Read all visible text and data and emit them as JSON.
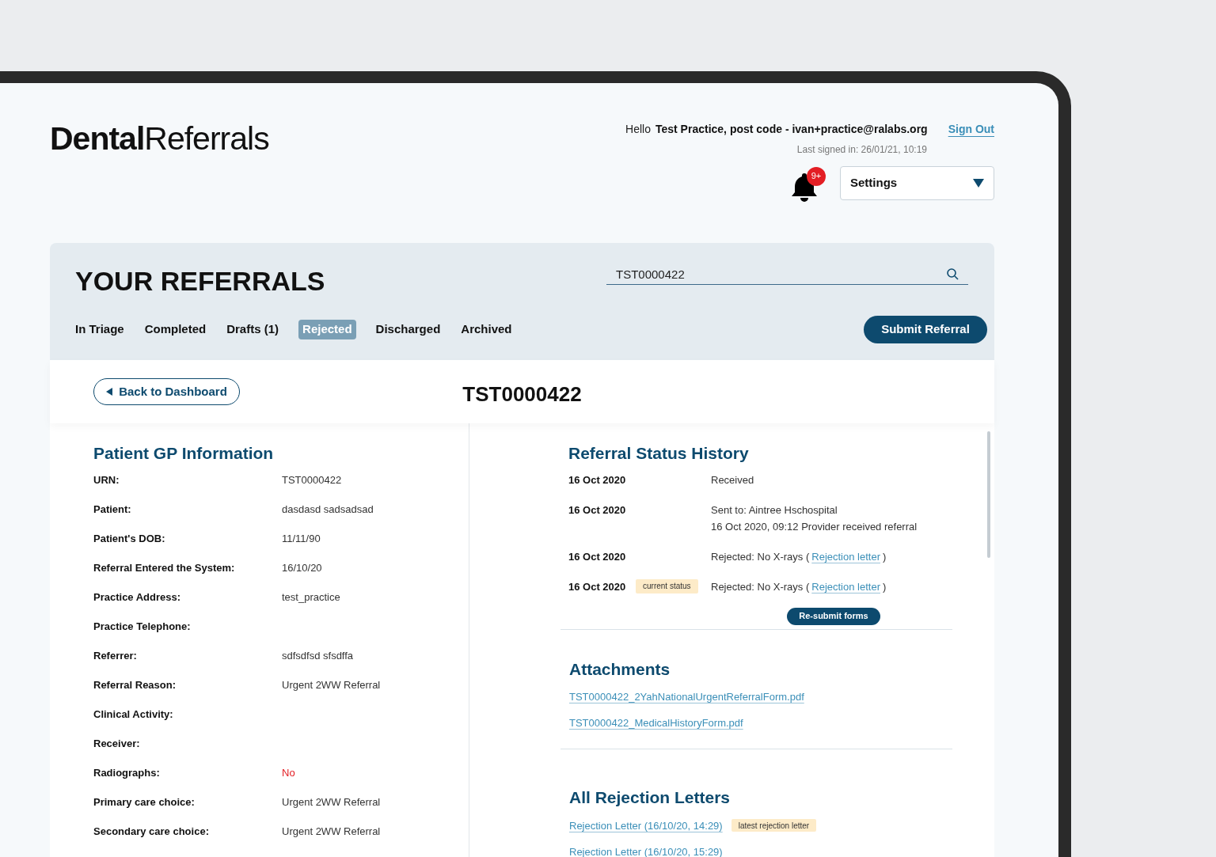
{
  "header": {
    "logo": "**Dental**Referrals",
    "greeting": "Hello",
    "user": "Test Practice, post code - ivan+practice@ralabs.org",
    "sign_out": "Sign Out",
    "last_signed": "Last signed in: 26/01/21, 10:19",
    "notifications": "9+",
    "settings": "Settings"
  },
  "panel": {
    "title": "YOUR REFERRALS",
    "search": {
      "value": "TST0000422"
    },
    "tabs": [
      {
        "label": "In Triage",
        "selected": false
      },
      {
        "label": "Completed",
        "selected": false
      },
      {
        "label": "Drafts (1)",
        "selected": false
      },
      {
        "label": "Rejected",
        "selected": true
      },
      {
        "label": "Discharged",
        "selected": false
      },
      {
        "label": "Archived",
        "selected": false
      }
    ],
    "submit": "Submit Referral"
  },
  "back": "Back to Dashboard",
  "referral_id": "TST0000422",
  "patient": {
    "heading": "Patient GP Information",
    "rows": [
      {
        "label": "URN:",
        "value": "TST0000422",
        "warning": false
      },
      {
        "label": "Patient:",
        "value": "dasdasd sadsadsad",
        "warning": false
      },
      {
        "label": "Patient's DOB:",
        "value": "11/11/90",
        "warning": false
      },
      {
        "label": "Referral Entered the System:",
        "value": "16/10/20",
        "warning": false
      },
      {
        "label": "Practice Address:",
        "value": "test_practice",
        "warning": false
      },
      {
        "label": "Practice Telephone:"
      },
      {
        "label": "Referrer:",
        "value": "sdfsdfsd sfsdffa",
        "warning": false
      },
      {
        "label": "Referral Reason:",
        "value": "Urgent 2WW Referral",
        "warning": false
      },
      {
        "label": "Clinical Activity:"
      },
      {
        "label": "Receiver:"
      },
      {
        "label": "Radiographs:",
        "value": "No",
        "warning": true
      },
      {
        "label": "Primary care choice:",
        "value": "Urgent 2WW Referral",
        "warning": false
      },
      {
        "label": "Secondary care choice:",
        "value": "Urgent 2WW Referral",
        "warning": false
      }
    ]
  },
  "history": {
    "heading": "Referral Status History",
    "items": [
      {
        "date": "16 Oct 2020",
        "lines": [
          {
            "text": "Received"
          }
        ]
      },
      {
        "date": "16 Oct 2020",
        "lines": [
          {
            "text": "Sent to: Aintree Hschospital"
          },
          {
            "text": "16 Oct 2020, 09:12 Provider received referral"
          }
        ]
      },
      {
        "date": "16 Oct 2020",
        "lines": [
          {
            "text": "Rejected: No X-rays (",
            "link": "Rejection letter",
            "after": ")"
          }
        ]
      },
      {
        "date": "16 Oct 2020",
        "badge": "current status",
        "lines": [
          {
            "text": "Rejected: No X-rays (",
            "link": "Rejection letter",
            "after": ")"
          }
        ]
      }
    ],
    "resubmit": "Re-submit forms"
  },
  "attachments": {
    "heading": "Attachments",
    "files": [
      "TST0000422_2YahNationalUrgentReferralForm.pdf",
      "TST0000422_MedicalHistoryForm.pdf"
    ]
  },
  "rejection_letters": {
    "heading": "All Rejection Letters",
    "letters": [
      {
        "label": "Rejection Letter (16/10/20, 14:29)",
        "badge": "latest rejection letter"
      },
      {
        "label": "Rejection Letter (16/10/20, 15:29)"
      }
    ]
  }
}
